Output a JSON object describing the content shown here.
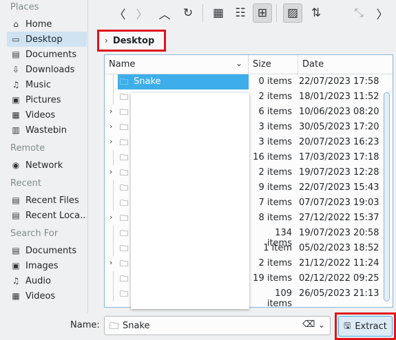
{
  "places": {
    "sections": [
      {
        "title": "Places",
        "items": [
          {
            "label": "Home",
            "icon": "home-icon",
            "glyph": "⌂"
          },
          {
            "label": "Desktop",
            "icon": "desktop-icon",
            "glyph": "▭",
            "selected": true
          },
          {
            "label": "Documents",
            "icon": "document-icon",
            "glyph": "▤"
          },
          {
            "label": "Downloads",
            "icon": "download-icon",
            "glyph": "⇩"
          },
          {
            "label": "Music",
            "icon": "music-icon",
            "glyph": "♫"
          },
          {
            "label": "Pictures",
            "icon": "picture-icon",
            "glyph": "▣"
          },
          {
            "label": "Videos",
            "icon": "video-icon",
            "glyph": "▦"
          },
          {
            "label": "Wastebin",
            "icon": "trash-icon",
            "glyph": "▥"
          }
        ]
      },
      {
        "title": "Remote",
        "items": [
          {
            "label": "Network",
            "icon": "network-icon",
            "glyph": "◉"
          }
        ]
      },
      {
        "title": "Recent",
        "items": [
          {
            "label": "Recent Files",
            "icon": "recent-files-icon",
            "glyph": "▤"
          },
          {
            "label": "Recent Loca...",
            "icon": "recent-locations-icon",
            "glyph": "▤"
          }
        ]
      },
      {
        "title": "Search For",
        "items": [
          {
            "label": "Documents",
            "icon": "search-documents-icon",
            "glyph": "▤"
          },
          {
            "label": "Images",
            "icon": "search-images-icon",
            "glyph": "▣"
          },
          {
            "label": "Audio",
            "icon": "search-audio-icon",
            "glyph": "♫"
          },
          {
            "label": "Videos",
            "icon": "search-videos-icon",
            "glyph": "▦"
          }
        ]
      }
    ]
  },
  "toolbar": {
    "buttons": [
      {
        "name": "back-icon",
        "glyph": "〈"
      },
      {
        "name": "forward-icon",
        "glyph": "〉",
        "disabled": true
      },
      {
        "name": "up-icon",
        "glyph": "︿"
      },
      {
        "name": "reload-icon",
        "glyph": "↻"
      },
      {
        "name": "icon-view-icon",
        "glyph": "▦"
      },
      {
        "name": "detail-view-icon",
        "glyph": "☷"
      },
      {
        "name": "tree-view-icon",
        "glyph": "⊞",
        "checked": true
      },
      {
        "name": "preview-icon",
        "glyph": "▨",
        "checked": true
      },
      {
        "name": "sort-icon",
        "glyph": "⇅"
      },
      {
        "name": "zoom-icon",
        "glyph": "⤡",
        "disabled": true
      },
      {
        "name": "more-icon",
        "glyph": "〉"
      }
    ]
  },
  "breadcrumb": {
    "chevron": "›",
    "label": "Desktop"
  },
  "table": {
    "headers": {
      "name": "Name",
      "size": "Size",
      "date": "Date"
    },
    "rows": [
      {
        "name": "Snake",
        "size": "0 items",
        "date": "22/07/2023 17:58",
        "expandable": false,
        "selected": true
      },
      {
        "name": "",
        "size": "2 items",
        "date": "18/01/2023 11:52",
        "expandable": false
      },
      {
        "name": "",
        "size": "6 items",
        "date": "10/06/2023 08:20",
        "expandable": true
      },
      {
        "name": "",
        "size": "3 items",
        "date": "30/05/2023 17:20",
        "expandable": true
      },
      {
        "name": "",
        "size": "3 items",
        "date": "20/07/2023 16:23",
        "expandable": true
      },
      {
        "name": "",
        "size": "16 items",
        "date": "17/03/2023 17:18",
        "expandable": false
      },
      {
        "name": "",
        "size": "2 items",
        "date": "19/07/2023 12:28",
        "expandable": true
      },
      {
        "name": "",
        "size": "9 items",
        "date": "22/07/2023 15:43",
        "expandable": false
      },
      {
        "name": "",
        "size": "7 items",
        "date": "07/07/2023 19:03",
        "expandable": false
      },
      {
        "name": "",
        "size": "8 items",
        "date": "27/12/2022 15:37",
        "expandable": true
      },
      {
        "name": "",
        "size": "134 items",
        "date": "19/07/2023 20:58",
        "expandable": false
      },
      {
        "name": "",
        "size": "1 item",
        "date": "05/02/2023 18:52",
        "expandable": false
      },
      {
        "name": "",
        "size": "2 items",
        "date": "21/12/2022 11:24",
        "expandable": true
      },
      {
        "name": "",
        "size": "19 items",
        "date": "02/12/2022 09:25",
        "expandable": false
      },
      {
        "name": "",
        "size": "109 items",
        "date": "26/05/2023 21:13",
        "expandable": false
      }
    ]
  },
  "footer": {
    "name_label": "Name:",
    "name_value": "Snake",
    "extract_label": "Extract"
  },
  "colors": {
    "accent": "#3daee9",
    "highlight_outline": "#e1141b"
  }
}
